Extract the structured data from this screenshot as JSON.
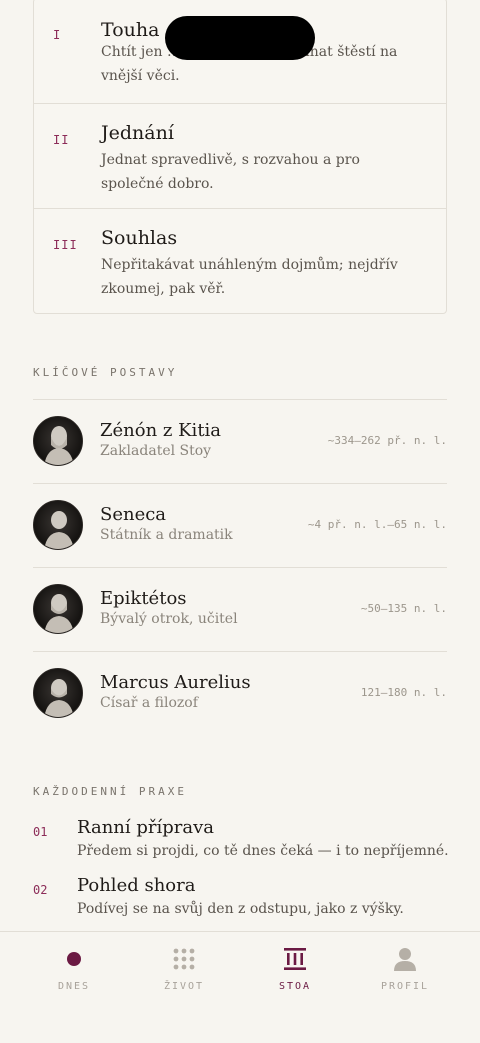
{
  "disciplines": [
    {
      "num": "I",
      "title": "Touha",
      "desc": "Chtít jen … přírodou — neupínat štěstí na vnější věci."
    },
    {
      "num": "II",
      "title": "Jednání",
      "desc": "Jednat spravedlivě, s rozvahou a pro společné dobro."
    },
    {
      "num": "III",
      "title": "Souhlas",
      "desc": "Nepřitakávat unáhleným dojmům; nejdřív zkoumej, pak věř."
    }
  ],
  "figures_label": "KLÍČOVÉ POSTAVY",
  "figures": [
    {
      "name": "Zénón z Kitia",
      "role": "Zakladatel Stoy",
      "dates": "~334–262 př. n. l."
    },
    {
      "name": "Seneca",
      "role": "Státník a dramatik",
      "dates": "~4 př. n. l.–65 n. l."
    },
    {
      "name": "Epiktétos",
      "role": "Bývalý otrok, učitel",
      "dates": "~50–135 n. l."
    },
    {
      "name": "Marcus Aurelius",
      "role": "Císař a filozof",
      "dates": "121–180 n. l."
    }
  ],
  "practice_label": "KAŽDODENNÍ PRAXE",
  "practices": [
    {
      "num": "01",
      "title": "Ranní příprava",
      "desc": "Předem si projdi, co tě dnes čeká — i to nepříjemné."
    },
    {
      "num": "02",
      "title": "Pohled shora",
      "desc": "Podívej se na svůj den z odstupu, jako z výšky."
    }
  ],
  "tabs": [
    {
      "label": "DNES",
      "icon": "dot-icon",
      "active": false
    },
    {
      "label": "ŽIVOT",
      "icon": "grid-icon",
      "active": false
    },
    {
      "label": "STOA",
      "icon": "columns-icon",
      "active": true
    },
    {
      "label": "PROFIL",
      "icon": "person-icon",
      "active": false
    }
  ],
  "colors": {
    "accent": "#6b1a43",
    "numeral": "#8c2c58",
    "background": "#f7f5f0",
    "inactive": "#a8a29a"
  }
}
